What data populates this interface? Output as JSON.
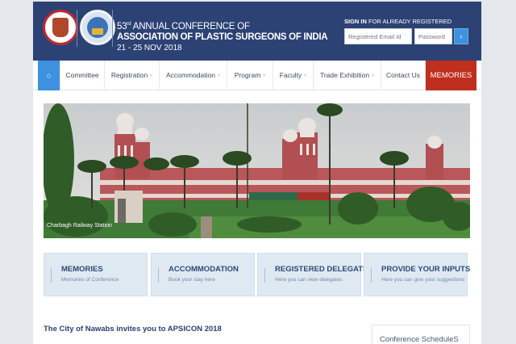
{
  "header": {
    "title_ordinal": "53",
    "title_suffix": "rd",
    "title_line1": "ANNUAL CONFERENCE OF",
    "title_line2": "ASSOCIATION OF PLASTIC SURGEONS OF INDIA",
    "dates": "21 - 25 NOV 2018",
    "signin_bold": "SIGN IN",
    "signin_rest": " FOR ALREADY REGISTERED",
    "email_placeholder": "Registered Email Id",
    "password_placeholder": "Password"
  },
  "nav": {
    "items": [
      {
        "label": "Committee"
      },
      {
        "label": "Registration"
      },
      {
        "label": "Accommodation"
      },
      {
        "label": "Program"
      },
      {
        "label": "Faculty"
      },
      {
        "label": "Trade Exhibition"
      },
      {
        "label": "Contact Us"
      }
    ],
    "memories_label": "MEMORIES"
  },
  "hero": {
    "caption": "Charbagh Railway Station"
  },
  "cards": [
    {
      "title": "MEMORIES",
      "subtitle": "Memories of Conference"
    },
    {
      "title": "ACCOMMODATION",
      "subtitle": "Book your stay here"
    },
    {
      "title": "REGISTERED DELEGATE",
      "subtitle": "Here you can view delegates"
    },
    {
      "title": "PROVIDE YOUR INPUTS",
      "subtitle": "Here you can give your suggestions"
    }
  ],
  "main": {
    "welcome": "The City of Nawabs invites you to APSICON 2018",
    "schedule": "Conference ScheduleS"
  },
  "colors": {
    "header_bg": "#2c4274",
    "accent_blue": "#3e91de",
    "memories_red": "#c02e1e",
    "card_bg": "#dfe9f2"
  }
}
